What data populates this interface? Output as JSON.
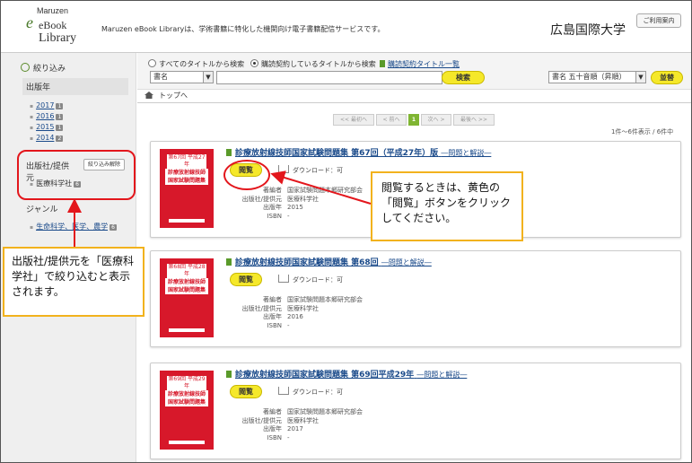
{
  "header": {
    "logo_maruzen": "Maruzen",
    "logo_ebook": "eBook",
    "logo_library": "Library",
    "description": "Maruzen eBook Libraryは、学術書籍に特化した機関向け電子書籍配信サービスです。",
    "university": "広島国際大学",
    "guide_label": "ご利用案内"
  },
  "sidebar": {
    "filter_label": "絞り込み",
    "year_heading": "出版年",
    "years": [
      {
        "label": "2017",
        "count": "1"
      },
      {
        "label": "2016",
        "count": "1"
      },
      {
        "label": "2015",
        "count": "1"
      },
      {
        "label": "2014",
        "count": "2"
      }
    ],
    "publisher_heading": "出版社/提供元",
    "clear_label": "絞り込み解除",
    "publisher_item": {
      "label": "医療科学社",
      "count": "6"
    },
    "genre_heading": "ジャンル",
    "genre_item": {
      "label": "生命科学、医学、農学",
      "count": "6"
    }
  },
  "search": {
    "radio_all": "すべてのタイトルから検索",
    "radio_contract": "購読契約しているタイトルから検索",
    "contract_link": "購読契約タイトル一覧",
    "field_select": "書名",
    "search_button": "検索",
    "sort_select": "書名 五十音順（昇順）",
    "sort_button": "並替"
  },
  "breadcrumb": {
    "home": "トップへ"
  },
  "pager": {
    "first": "<< 最初へ",
    "prev": "< 前へ",
    "current": "1",
    "next": "次へ >",
    "last": "最後へ >>",
    "count_text": "1件～6件表示 / 6件中"
  },
  "books": [
    {
      "title": "診療放射線技師国家試験問題集 第67回（平成27年）版",
      "subtitle": "―問題と解説―",
      "cover_top": "第67回 平成27年",
      "cover_main": "診療放射線技師 国家試験問題集",
      "read_label": "閲覧",
      "download_label": "ダウンロード：可",
      "author_key": "著編者",
      "author": "国家試験問題本郷研究部会",
      "publisher_key": "出版社/提供元",
      "publisher": "医療科学社",
      "year_key": "出版年",
      "year": "2015",
      "isbn_key": "ISBN",
      "isbn": "-"
    },
    {
      "title": "診療放射線技師国家試験問題集 第68回",
      "subtitle": "―問題と解説―",
      "cover_top": "第68回 平成28年",
      "cover_main": "診療放射線技師 国家試験問題集",
      "read_label": "閲覧",
      "download_label": "ダウンロード：可",
      "author_key": "著編者",
      "author": "国家試験問題本郷研究部会",
      "publisher_key": "出版社/提供元",
      "publisher": "医療科学社",
      "year_key": "出版年",
      "year": "2016",
      "isbn_key": "ISBN",
      "isbn": "-"
    },
    {
      "title": "診療放射線技師国家試験問題集 第69回平成29年",
      "subtitle": "―問題と解説―",
      "cover_top": "第69回 平成29年",
      "cover_main": "診療放射線技師 国家試験問題集",
      "read_label": "閲覧",
      "download_label": "ダウンロード：可",
      "author_key": "著編者",
      "author": "国家試験問題本郷研究部会",
      "publisher_key": "出版社/提供元",
      "publisher": "医療科学社",
      "year_key": "出版年",
      "year": "2017",
      "isbn_key": "ISBN",
      "isbn": "-"
    }
  ],
  "callouts": {
    "publisher_note": "出版社/提供元を「医療科学社」で絞り込むと表示されます。",
    "read_note": "閲覧するときは、黄色の「閲覧」ボタンをクリックしてください。"
  },
  "colors": {
    "accent_green": "#7fb532",
    "button_yellow": "#f5e82a",
    "callout_red": "#e3161c",
    "callout_orange": "#f2b21d",
    "cover_red": "#d7182a"
  }
}
